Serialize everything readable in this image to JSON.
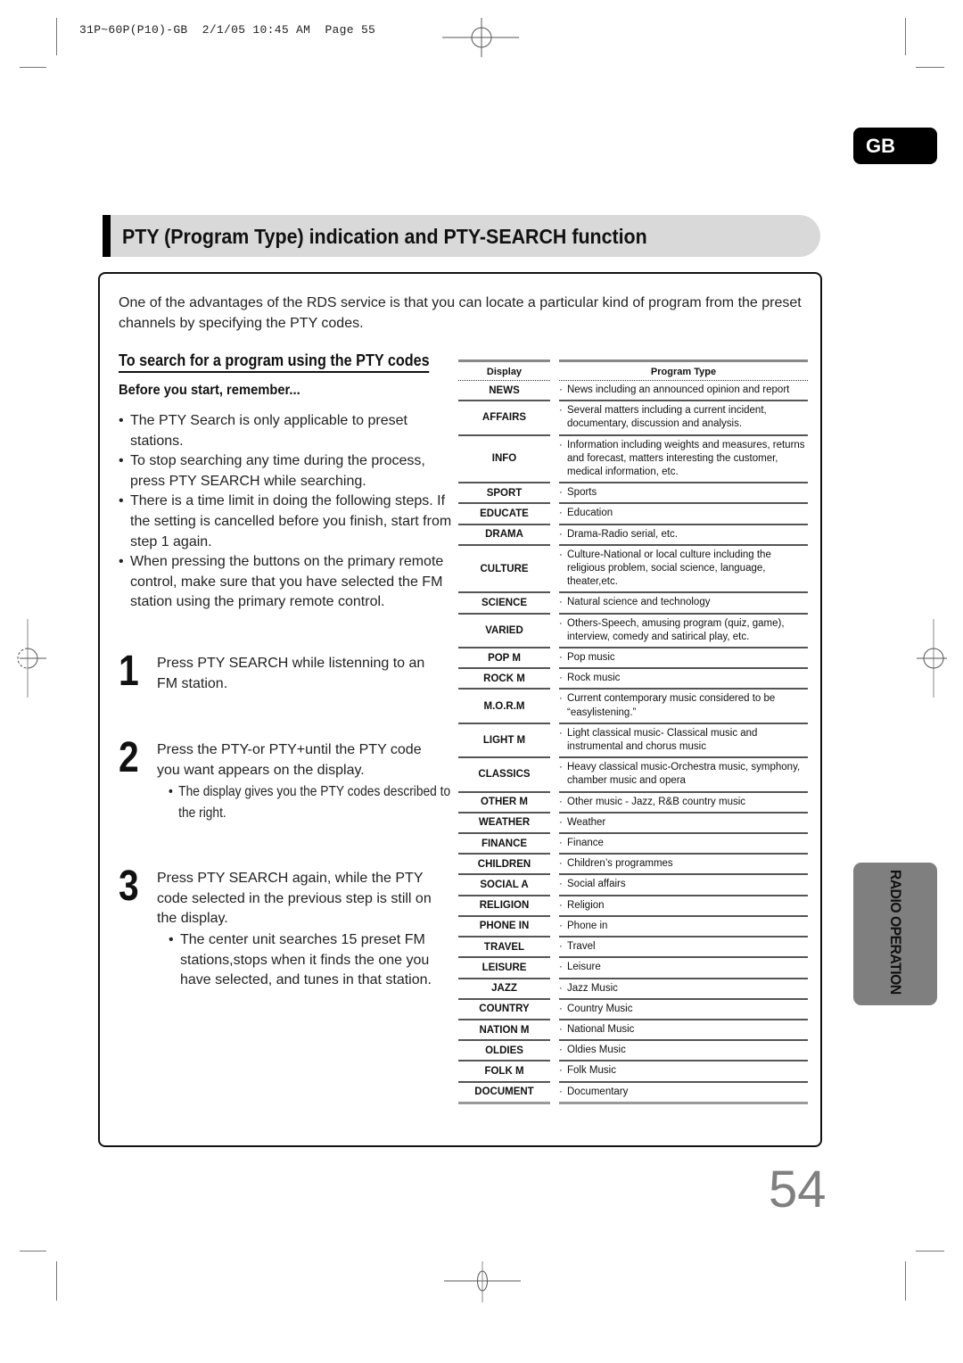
{
  "print_slug": "31P~60P(P10)-GB  2/1/05 10:45 AM  Page 55",
  "language_badge": "GB",
  "page_title": "PTY (Program Type) indication and PTY-SEARCH function",
  "intro_text": "One  of the advantages of the RDS service is that you can locate a particular kind of program from the preset channels by specifying the PTY codes.",
  "section_heading": "To search for a program using the PTY codes",
  "before_heading": "Before you start, remember...",
  "bullet_glyph": "•",
  "small_bullet_glyph": "·",
  "remember_bullets": [
    "The PTY Search is only applicable to preset stations.",
    "To stop searching any time during the process, press PTY SEARCH while searching.",
    "There is a time limit in doing the following steps. If the setting is cancelled before you finish, start from step 1 again.",
    "When pressing the buttons on the primary remote control, make sure that you have selected the FM station using the primary remote control."
  ],
  "steps": [
    {
      "number": "1",
      "text": "Press PTY SEARCH while listenning to an FM station.",
      "note": ""
    },
    {
      "number": "2",
      "text": "Press the PTY-or PTY+until the PTY code you want appears on the display.",
      "note": "The display gives you the PTY codes described to the right."
    },
    {
      "number": "3",
      "text": "Press PTY SEARCH again, while the PTY code selected in the previous step is still on the display.",
      "note": "The center unit searches 15 preset FM stations,stops when it finds the one you have selected, and tunes in that station."
    }
  ],
  "pty_table": {
    "headers": {
      "display": "Display",
      "program_type": "Program Type"
    },
    "rows": [
      {
        "code": "NEWS",
        "desc": "News including an announced opinion and report"
      },
      {
        "code": "AFFAIRS",
        "desc": "Several matters including a current incident, documentary, discussion and analysis."
      },
      {
        "code": "INFO",
        "desc": " Information including weights and measures, returns and forecast, matters interesting the customer, medical information, etc."
      },
      {
        "code": "SPORT",
        "desc": "Sports"
      },
      {
        "code": "EDUCATE",
        "desc": "Education"
      },
      {
        "code": "DRAMA",
        "desc": "Drama-Radio serial, etc."
      },
      {
        "code": "CULTURE",
        "desc": "Culture-National or local culture including the religious problem, social science, language, theater,etc."
      },
      {
        "code": "SCIENCE",
        "desc": "Natural science and technology"
      },
      {
        "code": "VARIED",
        "desc": "Others-Speech, amusing program (quiz, game), interview, comedy and satirical play, etc."
      },
      {
        "code": "POP M",
        "desc": "Pop music"
      },
      {
        "code": "ROCK M",
        "desc": "Rock music"
      },
      {
        "code": "M.O.R.M",
        "desc": "Current contemporary music considered to be “easylistening.”"
      },
      {
        "code": "LIGHT M",
        "desc": "Light classical music- Classical music and instrumental and chorus music"
      },
      {
        "code": "CLASSICS",
        "desc": "Heavy classical  music-Orchestra music, symphony, chamber music and opera"
      },
      {
        "code": "OTHER M",
        "desc": "Other music - Jazz, R&B country music"
      },
      {
        "code": "WEATHER",
        "desc": "Weather"
      },
      {
        "code": "FINANCE",
        "desc": "Finance"
      },
      {
        "code": "CHILDREN",
        "desc": "Children’s programmes"
      },
      {
        "code": "SOCIAL A",
        "desc": "Social affairs"
      },
      {
        "code": "RELIGION",
        "desc": "Religion"
      },
      {
        "code": "PHONE IN",
        "desc": "Phone in"
      },
      {
        "code": "TRAVEL",
        "desc": "Travel"
      },
      {
        "code": "LEISURE",
        "desc": "Leisure"
      },
      {
        "code": "JAZZ",
        "desc": "Jazz Music"
      },
      {
        "code": "COUNTRY",
        "desc": "Country Music"
      },
      {
        "code": "NATION M",
        "desc": "National Music"
      },
      {
        "code": "OLDIES",
        "desc": "Oldies Music"
      },
      {
        "code": "FOLK M",
        "desc": "Folk Music"
      },
      {
        "code": "DOCUMENT",
        "desc": "Documentary"
      }
    ]
  },
  "side_tab": "RADIO OPERATION",
  "page_number": "54",
  "colors": {
    "title_bar": "#d9d9d9",
    "side_tab": "#7f7f7f",
    "page_number": "#808080",
    "badge": "#000000"
  }
}
